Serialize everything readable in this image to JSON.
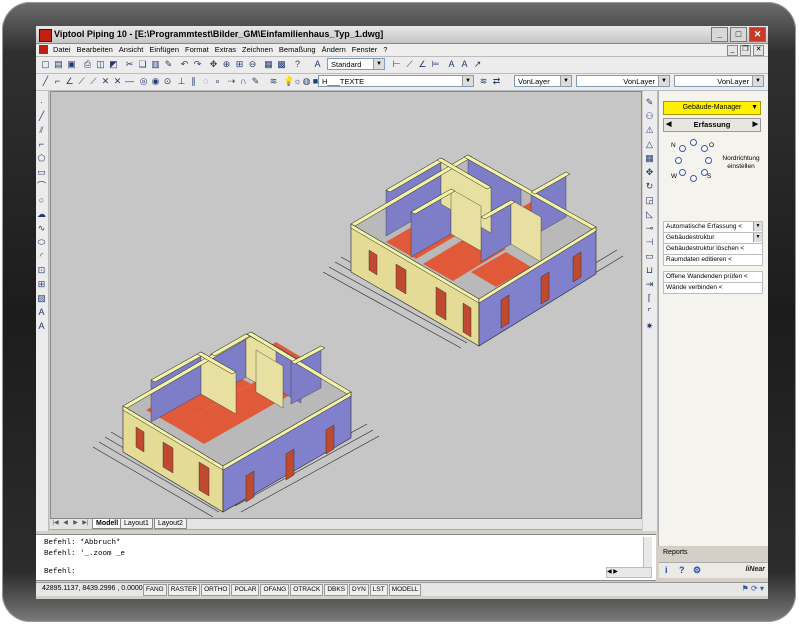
{
  "window": {
    "title": "Viptool Piping 10 - [E:\\Programmtest\\Bilder_GM\\Einfamilienhaus_Typ_1.dwg]",
    "minimize": "_",
    "maximize": "□",
    "close": "✕"
  },
  "menubar": {
    "items": [
      "Datei",
      "Bearbeiten",
      "Ansicht",
      "Einfügen",
      "Format",
      "Extras",
      "Zeichnen",
      "Bemaßung",
      "Ändern",
      "Fenster",
      "?"
    ]
  },
  "toolbar_standard": {
    "style_combo": "Standard"
  },
  "toolbar_layers": {
    "layer_combo": "H___TEXTE",
    "color_combo": "VonLayer",
    "linetype_combo": "VonLayer",
    "lineweight_combo": "VonLayer"
  },
  "tabs": [
    {
      "label": "Modell"
    },
    {
      "label": "Layout1"
    },
    {
      "label": "Layout2"
    }
  ],
  "panel": {
    "manager": "Gebäude-Manager",
    "section": "Erfassung",
    "compass": {
      "n": "N",
      "o": "O",
      "s": "S",
      "w": "W"
    },
    "nordrichtung": "Nordrichtung einstellen",
    "items": [
      {
        "label": "Automatische Erfassung <",
        "dropdown": true
      },
      {
        "label": "Gebäudestruktur",
        "dropdown": true
      },
      {
        "label": "Gebäudestruktur löschen <",
        "dropdown": false
      },
      {
        "label": "Raumdaten editieren <",
        "dropdown": false
      },
      {
        "label": "Offene Wandenden prüfen <",
        "dropdown": false
      },
      {
        "label": "Wände verbinden <",
        "dropdown": false
      }
    ],
    "reports": "Reports",
    "brand": "liNear"
  },
  "command": {
    "lines": [
      "Befehl: *Abbruch*",
      "Befehl: '_.zoom _e"
    ],
    "prompt": "Befehl:"
  },
  "statusbar": {
    "coords": "42895.1137, 8439.2996 , 0.0000",
    "toggles": [
      "FANG",
      "RASTER",
      "ORTHO",
      "POLAR",
      "OFANG",
      "OTRACK",
      "DBKS",
      "DYN",
      "LST",
      "MODELL"
    ]
  },
  "colors": {
    "canvas": "#c6c6c6",
    "wall_top": "#f0f0a0",
    "wall_outer": "#e4dc96",
    "wall_inner": "#7e7ec8",
    "floor": "#e05a3a",
    "highlight": "#fff000"
  }
}
